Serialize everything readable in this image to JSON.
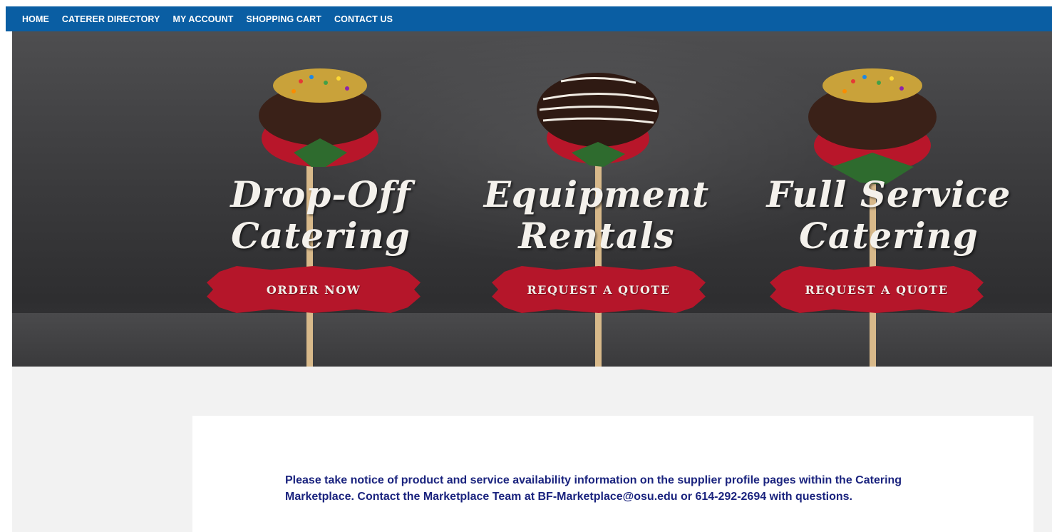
{
  "nav": {
    "items": [
      "HOME",
      "CATERER DIRECTORY",
      "MY ACCOUNT",
      "SHOPPING CART",
      "CONTACT US"
    ]
  },
  "hero": {
    "panels": [
      {
        "title_line1": "Drop-Off",
        "title_line2": "Catering",
        "button": "ORDER NOW"
      },
      {
        "title_line1": "Equipment",
        "title_line2": "Rentals",
        "button": "REQUEST A QUOTE"
      },
      {
        "title_line1": "Full Service",
        "title_line2": "Catering",
        "button": "REQUEST A QUOTE"
      }
    ]
  },
  "notice": {
    "text": "Please take notice of product and service availability information on the supplier profile pages within the Catering Marketplace. Contact the Marketplace Team at BF-Marketplace@osu.edu or 614-292-2694 with questions."
  },
  "colors": {
    "nav_bg": "#0a5ea3",
    "button_red": "#b5162a",
    "notice_text": "#1a237e"
  }
}
